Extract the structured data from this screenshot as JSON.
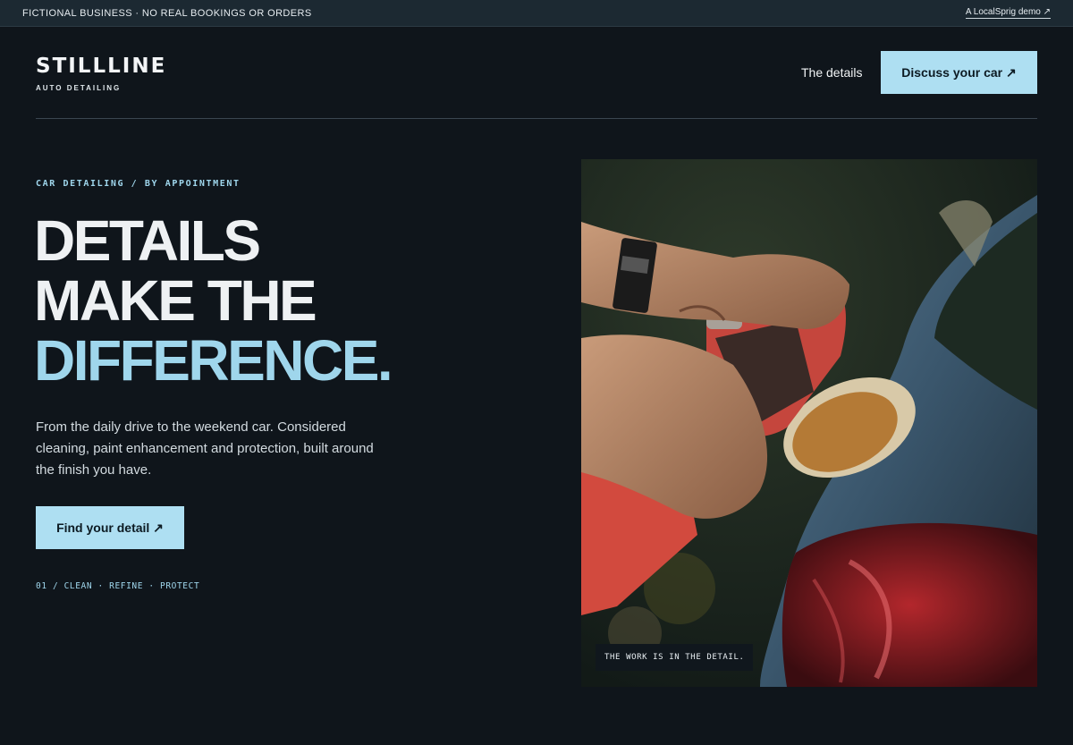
{
  "topbar": {
    "note": "FICTIONAL BUSINESS · NO REAL BOOKINGS OR ORDERS",
    "demo_link": "A LocalSprig demo ↗"
  },
  "header": {
    "brand": "STILLLINE",
    "tagline": "AUTO DETAILING",
    "nav_details": "The details",
    "cta": "Discuss your car ↗"
  },
  "hero": {
    "eyebrow": "CAR DETAILING / BY APPOINTMENT",
    "headline_line1": "DETAILS",
    "headline_line2": "MAKE THE",
    "headline_line3": "DIFFERENCE.",
    "lede": "From the daily drive to the weekend car. Considered cleaning, paint enhancement and protection, built around the finish you have.",
    "cta": "Find your detail ↗",
    "steps": "01 / CLEAN · REFINE · PROTECT"
  },
  "photo": {
    "caption": "THE WORK IS IN THE DETAIL."
  },
  "colors": {
    "background": "#0f151b",
    "accent": "#aedff2",
    "accent_text": "#9fd6ec",
    "topbar": "#1c2932"
  }
}
